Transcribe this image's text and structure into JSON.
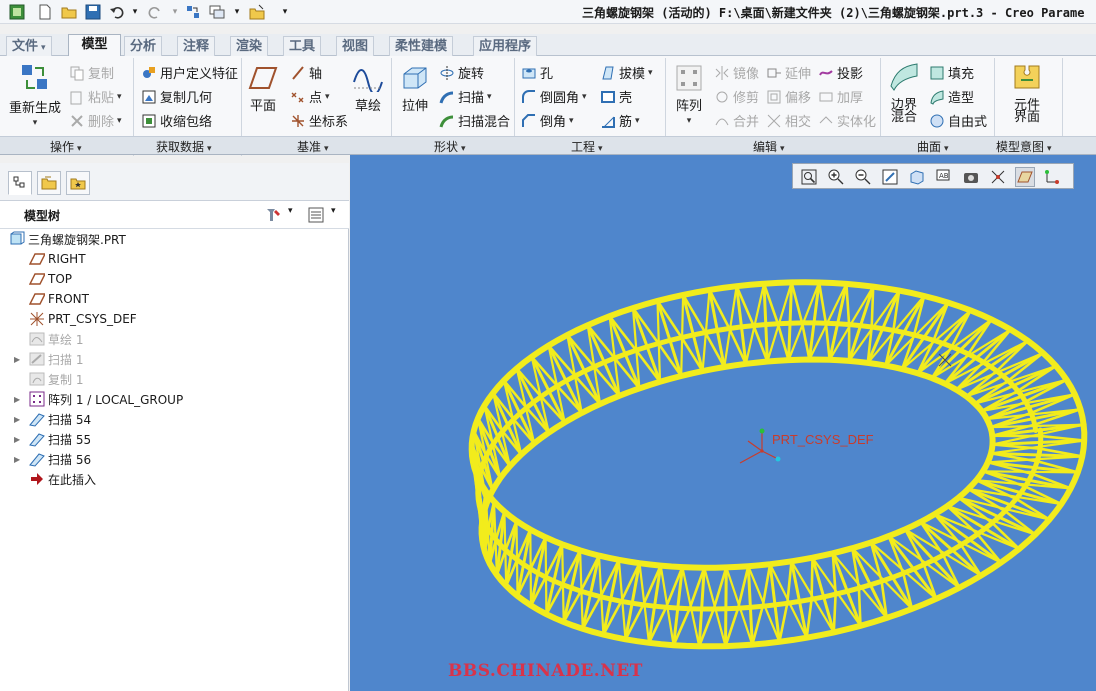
{
  "window": {
    "title": "三角螺旋钢架 (活动的) F:\\桌面\\新建文件夹 (2)\\三角螺旋钢架.prt.3 - Creo Parame"
  },
  "tabs": [
    {
      "label": "文件",
      "caret": "▾"
    },
    {
      "label": "模型"
    },
    {
      "label": "分析"
    },
    {
      "label": "注释"
    },
    {
      "label": "渲染"
    },
    {
      "label": "工具"
    },
    {
      "label": "视图"
    },
    {
      "label": "柔性建模"
    },
    {
      "label": "应用程序"
    }
  ],
  "active_tab": "模型",
  "ribbon": {
    "operations": {
      "regenerate": "重新生成",
      "copy": "复制",
      "paste": "粘贴",
      "delete": "删除"
    },
    "get_data": {
      "udf": "用户定义特征",
      "copy_geom": "复制几何",
      "shrinkwrap": "收缩包络"
    },
    "datum": {
      "plane": "平面",
      "axis": "轴",
      "point": "点",
      "csys": "坐标系",
      "sketch": "草绘"
    },
    "shapes": {
      "extrude": "拉伸",
      "revolve": "旋转",
      "sweep": "扫描",
      "swept_blend": "扫描混合"
    },
    "engineering": {
      "hole": "孔",
      "round": "倒圆角",
      "chamfer": "倒角",
      "draft": "拔模",
      "shell": "壳",
      "rib": "筋"
    },
    "editing": {
      "pattern": "阵列",
      "mirror": "镜像",
      "trim": "修剪",
      "merge": "合并",
      "extend": "延伸",
      "offset": "偏移",
      "intersect": "相交",
      "project": "投影",
      "thicken": "加厚",
      "solidify": "实体化"
    },
    "surfaces": {
      "boundary_blend": "边界\n混合",
      "fill": "填充",
      "style": "造型",
      "freestyle": "自由式"
    },
    "intent": {
      "component_interface": "元件\n界面"
    }
  },
  "groups": [
    {
      "label": "操作",
      "caret": "▾"
    },
    {
      "label": "获取数据",
      "caret": "▾"
    },
    {
      "label": "基准",
      "caret": "▾"
    },
    {
      "label": "形状",
      "caret": "▾"
    },
    {
      "label": "工程",
      "caret": "▾"
    },
    {
      "label": "编辑",
      "caret": "▾"
    },
    {
      "label": "曲面",
      "caret": "▾"
    },
    {
      "label": "模型意图",
      "caret": "▾"
    }
  ],
  "model_tree": {
    "title": "模型树",
    "items": [
      {
        "label": "三角螺旋钢架.PRT",
        "icon": "part-icon"
      },
      {
        "label": "RIGHT",
        "icon": "datum-plane-icon"
      },
      {
        "label": "TOP",
        "icon": "datum-plane-icon"
      },
      {
        "label": "FRONT",
        "icon": "datum-plane-icon"
      },
      {
        "label": "PRT_CSYS_DEF",
        "icon": "csys-icon"
      },
      {
        "label": "草绘 1",
        "icon": "sketch-icon"
      },
      {
        "label": "扫描 1",
        "icon": "sweep-icon"
      },
      {
        "label": "复制 1",
        "icon": "copy-icon"
      },
      {
        "label": "阵列 1 / LOCAL_GROUP",
        "icon": "pattern-icon"
      },
      {
        "label": "扫描 54",
        "icon": "sweep-icon"
      },
      {
        "label": "扫描 55",
        "icon": "sweep-icon"
      },
      {
        "label": "扫描 56",
        "icon": "sweep-icon"
      },
      {
        "label": "在此插入",
        "icon": "insert-arrow-icon"
      }
    ]
  },
  "viewport": {
    "csys_label": "PRT_CSYS_DEF",
    "watermark": "BBS.CHINADE.NET",
    "background": "#4f86cc",
    "model_color": "#f2ec1c"
  },
  "view_toolbar": [
    "refit-icon",
    "zoom-in-icon",
    "zoom-out-icon",
    "repaint-icon",
    "saved-orientations-icon",
    "display-style-icon",
    "annotation-display-icon",
    "spin-center-icon",
    "datum-display-icon",
    "plane-display-icon",
    "csys-display-icon"
  ]
}
